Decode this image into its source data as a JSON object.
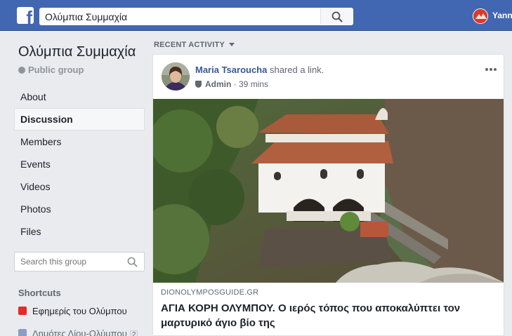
{
  "topbar": {
    "logo_icon": "facebook-f-icon",
    "search_value": "Ολύμπια Συμμαχία",
    "search_icon": "search-icon",
    "user_name": "Yann",
    "brand_color": "#4267b2"
  },
  "group": {
    "name": "Ολύμπια Συμμαχία",
    "privacy": "Public group",
    "privacy_icon": "globe-icon"
  },
  "nav": {
    "items": [
      {
        "label": "About",
        "active": false
      },
      {
        "label": "Discussion",
        "active": true
      },
      {
        "label": "Members",
        "active": false
      },
      {
        "label": "Events",
        "active": false
      },
      {
        "label": "Videos",
        "active": false
      },
      {
        "label": "Photos",
        "active": false
      },
      {
        "label": "Files",
        "active": false
      }
    ]
  },
  "group_search": {
    "placeholder": "Search this group"
  },
  "shortcuts": {
    "title": "Shortcuts",
    "items": [
      {
        "label": "Εφημερίς του Ολύμπου"
      },
      {
        "label": "Δημότες Δίου-Ολύμπου",
        "badge": "2"
      }
    ]
  },
  "feed": {
    "section_label": "RECENT ACTIVITY",
    "post": {
      "author": "Maria Tsaroucha",
      "action": " shared a link.",
      "role": "Admin",
      "time": " · 39 mins",
      "link_source": "DIONOLYMPOSGUIDE.GR",
      "link_title": "ΑΓΙΑ ΚΟΡΗ ΟΛΥΜΠΟΥ. Ο ιερός τόπος που αποκαλύπτει τον μαρτυρικό άγιο βίο της"
    }
  }
}
